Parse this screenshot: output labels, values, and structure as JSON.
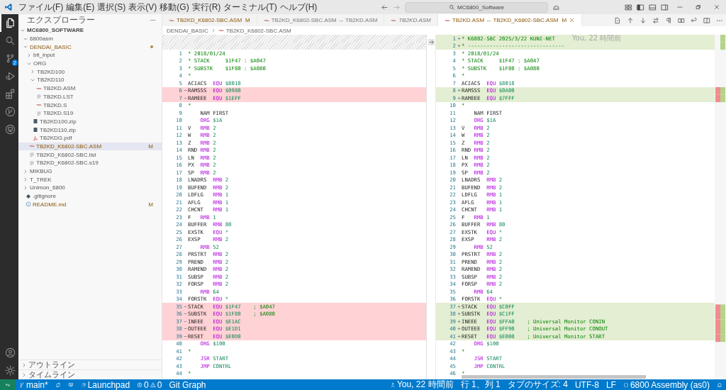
{
  "title_bar": {
    "menus": [
      "ファイル(F)",
      "編集(E)",
      "選択(S)",
      "表示(V)",
      "移動(G)",
      "実行(R)",
      "ターミナル(T)",
      "ヘルプ(H)"
    ],
    "search": "MC6800_Software"
  },
  "activity_bar": {
    "items": [
      {
        "kind": "explorer",
        "selected": true
      },
      {
        "kind": "search",
        "selected": false
      },
      {
        "kind": "source-control",
        "selected": false,
        "badge": "2"
      },
      {
        "kind": "run",
        "selected": false
      },
      {
        "kind": "extensions",
        "selected": false
      },
      {
        "kind": "gitlens",
        "selected": false
      },
      {
        "kind": "remote",
        "selected": false
      }
    ],
    "bottom": [
      {
        "kind": "account"
      },
      {
        "kind": "settings"
      }
    ]
  },
  "sidebar": {
    "title": "エクスプローラー",
    "section": "MC6800_SOFTWARE",
    "tree": [
      {
        "name": "6800asm",
        "kind": "folder",
        "expanded": true,
        "selected": false,
        "modified": false
      },
      {
        "name": "DENDAI_BASIC",
        "kind": "folder",
        "expanded": true,
        "selected": false,
        "modified": true,
        "children": [
          {
            "name": "bit_input",
            "kind": "folder",
            "expanded": false,
            "selected": false,
            "modified": false
          },
          {
            "name": "ORG",
            "kind": "folder",
            "expanded": true,
            "selected": false,
            "modified": false,
            "children": [
              {
                "name": "TB2KD100",
                "kind": "folder",
                "expanded": false,
                "selected": false,
                "modified": false
              },
              {
                "name": "TB2KD110",
                "kind": "folder",
                "expanded": true,
                "selected": false,
                "modified": false,
                "children": [
                  {
                    "name": "TB2KD.ASM",
                    "kind": "asm",
                    "selected": false,
                    "modified": false
                  },
                  {
                    "name": "TB2KD.LST",
                    "kind": "text",
                    "selected": false,
                    "modified": false
                  },
                  {
                    "name": "TB2KD.S",
                    "kind": "asm",
                    "selected": false,
                    "modified": false
                  },
                  {
                    "name": "TB2KD.S19",
                    "kind": "text",
                    "selected": false,
                    "modified": false
                  }
                ]
              },
              {
                "name": "TB2KD100.zip",
                "kind": "zip",
                "selected": false,
                "modified": false
              },
              {
                "name": "TB2KD110.zip",
                "kind": "zip",
                "selected": false,
                "modified": false
              },
              {
                "name": "TB2KDG.pdf",
                "kind": "pdf",
                "selected": false,
                "modified": false
              }
            ]
          },
          {
            "name": "TB2KD_K6802-SBC.ASM",
            "kind": "asm",
            "selected": true,
            "modified": true,
            "badge": "M"
          },
          {
            "name": "TB2KD_K6802-SBC.list",
            "kind": "text",
            "selected": false,
            "modified": false
          },
          {
            "name": "TB2KD_K6802-SBC.s19",
            "kind": "text",
            "selected": false,
            "modified": false
          }
        ]
      },
      {
        "name": "MIKBUG",
        "kind": "folder",
        "expanded": false,
        "selected": false,
        "modified": false
      },
      {
        "name": "T_TREK",
        "kind": "folder",
        "expanded": false,
        "selected": false,
        "modified": false
      },
      {
        "name": "Unimon_6800",
        "kind": "folder",
        "expanded": false,
        "selected": false,
        "modified": false
      },
      {
        "name": ".gitignore",
        "kind": "git",
        "selected": false,
        "modified": false
      },
      {
        "name": "README.md",
        "kind": "info",
        "selected": false,
        "modified": true,
        "badge": "M"
      }
    ],
    "panels": [
      {
        "label": "アウトライン",
        "expanded": false
      },
      {
        "label": "タイムライン",
        "expanded": false
      }
    ]
  },
  "tabs": [
    {
      "label": "TB2KD_K6802-SBC.ASM",
      "selected": false,
      "modified": true,
      "preview": false,
      "badge": "M"
    },
    {
      "label": "TB2KD_K6802-SBC.ASM ↔ TB2KD.ASM",
      "selected": false,
      "modified": false,
      "preview": false
    },
    {
      "label": "TB2KD.ASM",
      "selected": false,
      "modified": false,
      "preview": true
    },
    {
      "label": "TB2KD.ASM ↔ TB2KD_K6802-SBC.ASM",
      "selected": true,
      "modified": true,
      "preview": false,
      "badge": "M"
    }
  ],
  "breadcrumb": [
    {
      "kind": "folder",
      "text": "DENDAI_BASIC"
    },
    {
      "kind": "asm",
      "text": "TB2KD_K6802-SBC.ASM"
    }
  ],
  "diff": {
    "left": {
      "lines": [
        {
          "kind": "filler"
        },
        {
          "kind": "filler"
        },
        {
          "kind": "comment",
          "n": "1",
          "removed": false,
          "text": "* 2018/01/24"
        },
        {
          "kind": "comment",
          "n": "2",
          "removed": false,
          "text": "* STACK     $1F47 : $A047"
        },
        {
          "kind": "comment",
          "n": "3",
          "removed": false,
          "text": "* SUBSTK    $1F80 : $A080"
        },
        {
          "kind": "comment",
          "n": "4",
          "removed": false,
          "text": "*"
        },
        {
          "kind": "code",
          "n": "5",
          "removed": false,
          "label": "ACIACS",
          "op": "EQU",
          "operand": "$8018"
        },
        {
          "kind": "code",
          "n": "6",
          "removed": true,
          "label": "RAMSSS",
          "op": "EQU",
          "operand": "$0980"
        },
        {
          "kind": "code",
          "n": "7",
          "removed": true,
          "label": "RAMEEE",
          "op": "EQU",
          "operand": "$1EFF"
        },
        {
          "kind": "comment",
          "n": "8",
          "removed": false,
          "text": "*"
        },
        {
          "kind": "directive",
          "n": "9",
          "removed": false,
          "text": "NAM FIRST"
        },
        {
          "kind": "code",
          "n": "10",
          "removed": false,
          "op": "ORG",
          "operand": "$1A"
        },
        {
          "kind": "code",
          "n": "11",
          "removed": false,
          "label": "V",
          "op": "RMB",
          "operand": "2"
        },
        {
          "kind": "code",
          "n": "12",
          "removed": false,
          "label": "W",
          "op": "RMB",
          "operand": "2"
        },
        {
          "kind": "code",
          "n": "13",
          "removed": false,
          "label": "Z",
          "op": "RMB",
          "operand": "2"
        },
        {
          "kind": "code",
          "n": "14",
          "removed": false,
          "label": "RND",
          "op": "RMB",
          "operand": "2"
        },
        {
          "kind": "code",
          "n": "15",
          "removed": false,
          "label": "LN",
          "op": "RMB",
          "operand": "2"
        },
        {
          "kind": "code",
          "n": "16",
          "removed": false,
          "label": "PX",
          "op": "RMB",
          "operand": "2"
        },
        {
          "kind": "code",
          "n": "17",
          "removed": false,
          "label": "SP",
          "op": "RMB",
          "operand": "2"
        },
        {
          "kind": "code",
          "n": "18",
          "removed": false,
          "label": "LNADRS",
          "op": "RMB",
          "operand": "2"
        },
        {
          "kind": "code",
          "n": "19",
          "removed": false,
          "label": "BUFEND",
          "op": "RMB",
          "operand": "2"
        },
        {
          "kind": "code",
          "n": "20",
          "removed": false,
          "label": "LDFLG",
          "op": "RMB",
          "operand": "1"
        },
        {
          "kind": "code",
          "n": "21",
          "removed": false,
          "label": "AFLG",
          "op": "RMB",
          "operand": "1"
        },
        {
          "kind": "code",
          "n": "22",
          "removed": false,
          "label": "CHCNT",
          "op": "RMB",
          "operand": "1"
        },
        {
          "kind": "code",
          "n": "23",
          "removed": false,
          "label": "F",
          "op": "RMB",
          "operand": "1"
        },
        {
          "kind": "code",
          "n": "24",
          "removed": false,
          "label": "BUFFER",
          "op": "RMB",
          "operand": "80"
        },
        {
          "kind": "code",
          "n": "25",
          "removed": false,
          "label": "EXSTK",
          "op": "EQU",
          "operand": "*"
        },
        {
          "kind": "code",
          "n": "26",
          "removed": false,
          "label": "EXSP",
          "op": "RMB",
          "operand": "2"
        },
        {
          "kind": "code",
          "n": "27",
          "removed": false,
          "op": "RMB",
          "operand": "52"
        },
        {
          "kind": "code",
          "n": "28",
          "removed": false,
          "label": "PRSTRT",
          "op": "RMB",
          "operand": "2"
        },
        {
          "kind": "code",
          "n": "29",
          "removed": false,
          "label": "PREND",
          "op": "RMB",
          "operand": "2"
        },
        {
          "kind": "code",
          "n": "30",
          "removed": false,
          "label": "RAMEND",
          "op": "RMB",
          "operand": "2"
        },
        {
          "kind": "code",
          "n": "31",
          "removed": false,
          "label": "SUBSP",
          "op": "RMB",
          "operand": "2"
        },
        {
          "kind": "code",
          "n": "32",
          "removed": false,
          "label": "FORSP",
          "op": "RMB",
          "operand": "2"
        },
        {
          "kind": "code",
          "n": "33",
          "removed": false,
          "op": "RMB",
          "operand": "64"
        },
        {
          "kind": "code",
          "n": "34",
          "removed": false,
          "label": "FORSTK",
          "op": "EQU",
          "operand": "*"
        },
        {
          "kind": "code",
          "n": "35",
          "removed": true,
          "label": "STACK",
          "op": "EQU",
          "operand": "$1F47",
          "comment": "; $A047"
        },
        {
          "kind": "code",
          "n": "36",
          "removed": true,
          "label": "SUBSTK",
          "op": "EQU",
          "operand": "$1F80",
          "comment": "; $A080"
        },
        {
          "kind": "code",
          "n": "37",
          "removed": true,
          "label": "INEEE",
          "op": "EQU",
          "operand": "$E1AC"
        },
        {
          "kind": "code",
          "n": "38",
          "removed": true,
          "label": "OUTEEE",
          "op": "EQU",
          "operand": "$E1D1"
        },
        {
          "kind": "code",
          "n": "39",
          "removed": true,
          "label": "RESET",
          "op": "EQU",
          "operand": "$E0D0"
        },
        {
          "kind": "code",
          "n": "40",
          "removed": false,
          "op": "ORG",
          "operand": "$100"
        },
        {
          "kind": "comment",
          "n": "41",
          "removed": false,
          "text": "*"
        },
        {
          "kind": "code",
          "n": "42",
          "removed": false,
          "op": "JSR",
          "operand": "START"
        },
        {
          "kind": "code",
          "n": "43",
          "removed": false,
          "op": "JMP",
          "operand": "CONTRL"
        },
        {
          "kind": "comment",
          "n": "44",
          "removed": false,
          "text": "*"
        }
      ]
    },
    "right": {
      "lines": [
        {
          "kind": "comment",
          "n": "1",
          "added": true,
          "text": "* K6802-SBC 2025/3/22 KUNI-NET",
          "blame": "You, 22 時間前"
        },
        {
          "kind": "comment",
          "n": "2",
          "added": true,
          "text": "* -------------------------------"
        },
        {
          "kind": "comment",
          "n": "3",
          "added": false,
          "text": "* 2018/01/24"
        },
        {
          "kind": "comment",
          "n": "4",
          "added": false,
          "text": "* STACK     $1F47 : $A047"
        },
        {
          "kind": "comment",
          "n": "5",
          "added": false,
          "text": "* SUBSTK    $1F80 : $A080"
        },
        {
          "kind": "comment",
          "n": "6",
          "added": false,
          "text": "*"
        },
        {
          "kind": "code",
          "n": "7",
          "added": false,
          "label": "ACIACS",
          "op": "EQU",
          "operand": "$8018"
        },
        {
          "kind": "code",
          "n": "8",
          "added": true,
          "label": "RAMSSS",
          "op": "EQU",
          "operand": "$0A00"
        },
        {
          "kind": "code",
          "n": "9",
          "added": true,
          "label": "RAMEEE",
          "op": "EQU",
          "operand": "$7FFF"
        },
        {
          "kind": "comment",
          "n": "10",
          "added": false,
          "text": "*"
        },
        {
          "kind": "directive",
          "n": "11",
          "added": false,
          "text": "NAM FIRST"
        },
        {
          "kind": "code",
          "n": "12",
          "added": false,
          "op": "ORG",
          "operand": "$1A"
        },
        {
          "kind": "code",
          "n": "13",
          "added": false,
          "label": "V",
          "op": "RMB",
          "operand": "2"
        },
        {
          "kind": "code",
          "n": "14",
          "added": false,
          "label": "W",
          "op": "RMB",
          "operand": "2"
        },
        {
          "kind": "code",
          "n": "15",
          "added": false,
          "label": "Z",
          "op": "RMB",
          "operand": "2"
        },
        {
          "kind": "code",
          "n": "16",
          "added": false,
          "label": "RND",
          "op": "RMB",
          "operand": "2"
        },
        {
          "kind": "code",
          "n": "17",
          "added": false,
          "label": "LN",
          "op": "RMB",
          "operand": "2"
        },
        {
          "kind": "code",
          "n": "18",
          "added": false,
          "label": "PX",
          "op": "RMB",
          "operand": "2"
        },
        {
          "kind": "code",
          "n": "19",
          "added": false,
          "label": "SP",
          "op": "RMB",
          "operand": "2"
        },
        {
          "kind": "code",
          "n": "20",
          "added": false,
          "label": "LNADRS",
          "op": "RMB",
          "operand": "2"
        },
        {
          "kind": "code",
          "n": "21",
          "added": false,
          "label": "BUFEND",
          "op": "RMB",
          "operand": "2"
        },
        {
          "kind": "code",
          "n": "22",
          "added": false,
          "label": "LDFLG",
          "op": "RMB",
          "operand": "1"
        },
        {
          "kind": "code",
          "n": "23",
          "added": false,
          "label": "AFLG",
          "op": "RMB",
          "operand": "1"
        },
        {
          "kind": "code",
          "n": "24",
          "added": false,
          "label": "CHCNT",
          "op": "RMB",
          "operand": "1"
        },
        {
          "kind": "code",
          "n": "25",
          "added": false,
          "label": "F",
          "op": "RMB",
          "operand": "1"
        },
        {
          "kind": "code",
          "n": "26",
          "added": false,
          "label": "BUFFER",
          "op": "RMB",
          "operand": "80"
        },
        {
          "kind": "code",
          "n": "27",
          "added": false,
          "label": "EXSTK",
          "op": "EQU",
          "operand": "*"
        },
        {
          "kind": "code",
          "n": "28",
          "added": false,
          "label": "EXSP",
          "op": "RMB",
          "operand": "2"
        },
        {
          "kind": "code",
          "n": "29",
          "added": false,
          "op": "RMB",
          "operand": "52"
        },
        {
          "kind": "code",
          "n": "30",
          "added": false,
          "label": "PRSTRT",
          "op": "RMB",
          "operand": "2"
        },
        {
          "kind": "code",
          "n": "31",
          "added": false,
          "label": "PREND",
          "op": "RMB",
          "operand": "2"
        },
        {
          "kind": "code",
          "n": "32",
          "added": false,
          "label": "RAMEND",
          "op": "RMB",
          "operand": "2"
        },
        {
          "kind": "code",
          "n": "33",
          "added": false,
          "label": "SUBSP",
          "op": "RMB",
          "operand": "2"
        },
        {
          "kind": "code",
          "n": "34",
          "added": false,
          "label": "FORSP",
          "op": "RMB",
          "operand": "2"
        },
        {
          "kind": "code",
          "n": "35",
          "added": false,
          "op": "RMB",
          "operand": "64"
        },
        {
          "kind": "code",
          "n": "36",
          "added": false,
          "label": "FORSTK",
          "op": "EQU",
          "operand": "*"
        },
        {
          "kind": "code",
          "n": "37",
          "added": true,
          "label": "STACK",
          "op": "EQU",
          "operand": "$C0FF"
        },
        {
          "kind": "code",
          "n": "38",
          "added": true,
          "label": "SUBSTK",
          "op": "EQU",
          "operand": "$C1FF"
        },
        {
          "kind": "code",
          "n": "39",
          "added": true,
          "label": "INEEE",
          "op": "EQU",
          "operand": "$FFA0",
          "comment": "; Universal Monitor CONIN"
        },
        {
          "kind": "code",
          "n": "40",
          "added": true,
          "label": "OUTEEE",
          "op": "EQU",
          "operand": "$FF90",
          "comment": "; Universal Monitor CONOUT"
        },
        {
          "kind": "code",
          "n": "41",
          "added": true,
          "label": "RESET",
          "op": "EQU",
          "operand": "$E000",
          "comment": "; Universal Monitor START"
        },
        {
          "kind": "code",
          "n": "42",
          "added": false,
          "op": "ORG",
          "operand": "$100"
        },
        {
          "kind": "comment",
          "n": "43",
          "added": false,
          "text": "*"
        },
        {
          "kind": "code",
          "n": "44",
          "added": false,
          "op": "JSR",
          "operand": "START"
        },
        {
          "kind": "code",
          "n": "45",
          "added": false,
          "op": "JMP",
          "operand": "CONTRL"
        },
        {
          "kind": "comment",
          "n": "46",
          "added": false,
          "text": "*"
        }
      ]
    }
  },
  "status_bar": {
    "left": [
      {
        "kind": "remote"
      },
      {
        "kind": "branch",
        "text": "main*"
      },
      {
        "kind": "sync"
      },
      {
        "kind": "publish"
      },
      {
        "kind": "launchpad",
        "text": "Launchpad"
      },
      {
        "kind": "problems",
        "errors": "0",
        "warnings": "0"
      },
      {
        "kind": "text",
        "text": "Git Graph"
      }
    ],
    "right": [
      {
        "kind": "blame",
        "text": "You, 22 時間前"
      },
      {
        "kind": "text",
        "text": "行 1、列 1"
      },
      {
        "kind": "text",
        "text": "タブのサイズ: 4"
      },
      {
        "kind": "text",
        "text": "UTF-8"
      },
      {
        "kind": "text",
        "text": "LF"
      },
      {
        "kind": "language",
        "text": "6800 Assembly (as0)"
      },
      {
        "kind": "bell"
      }
    ]
  }
}
